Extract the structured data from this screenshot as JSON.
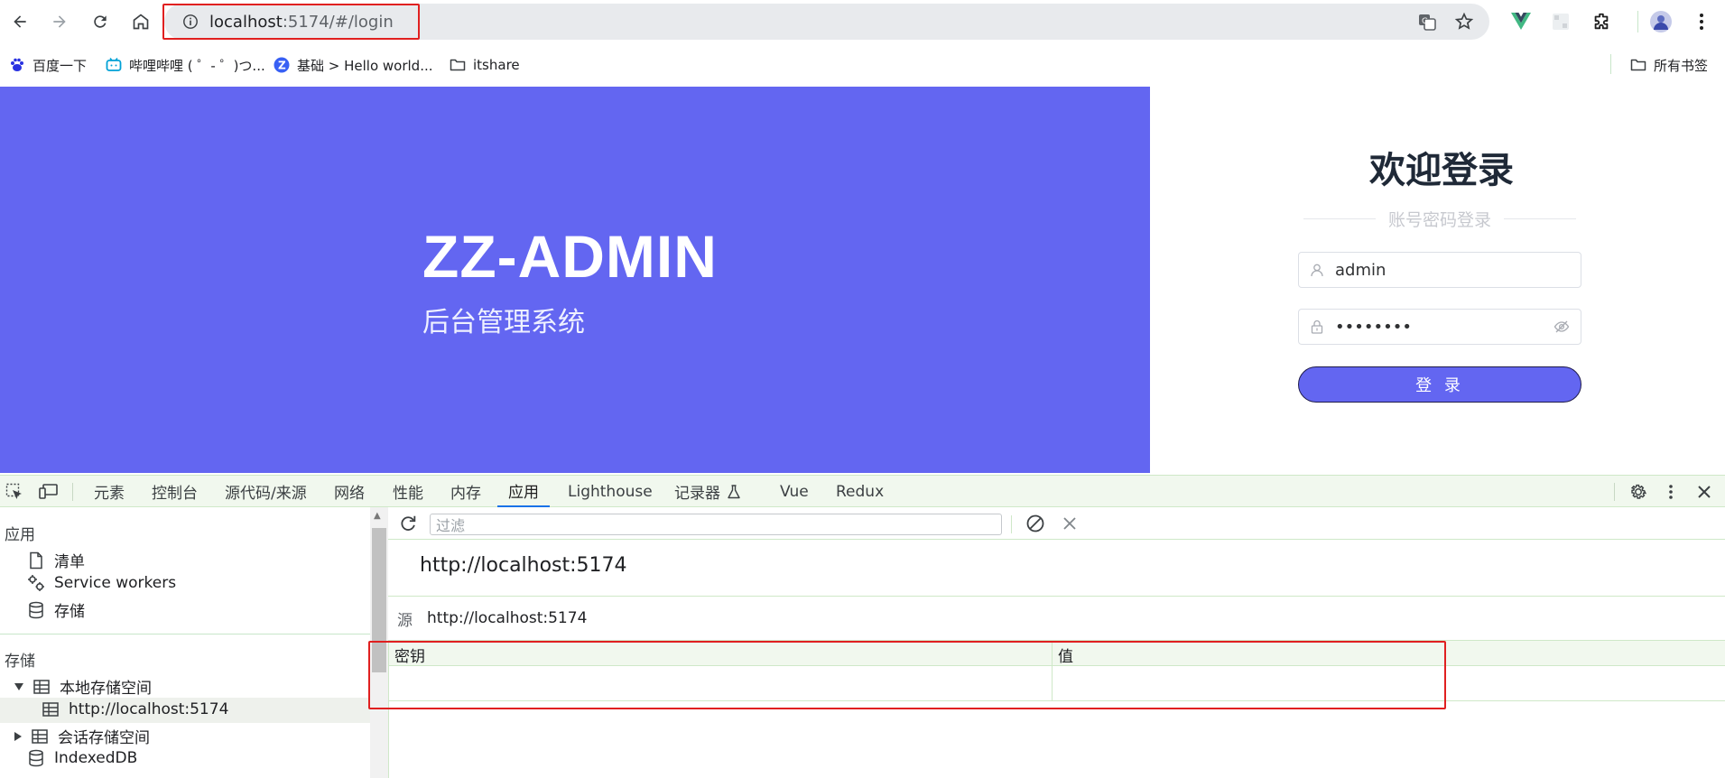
{
  "browser": {
    "url_host": "localhost",
    "url_rest": ":5174/#/login",
    "bookmarks": [
      {
        "label": "百度一下",
        "icon": "baidu-icon"
      },
      {
        "label": "哔哩哔哩 ( ゜- ゜)つ...",
        "icon": "bilibili-icon"
      },
      {
        "label": "基础 > Hello world...",
        "icon": "z-icon"
      },
      {
        "label": "itshare",
        "icon": "folder-icon"
      }
    ],
    "all_bookmarks": "所有书签"
  },
  "page": {
    "hero_title": "ZZ-ADMIN",
    "hero_subtitle": "后台管理系统",
    "login_title": "欢迎登录",
    "login_subtitle": "账号密码登录",
    "username_value": "admin",
    "password_value": "••••••••",
    "login_button": "登 录",
    "colors": {
      "brand": "#6366f1"
    }
  },
  "devtools": {
    "tabs": [
      "元素",
      "控制台",
      "源代码/来源",
      "网络",
      "性能",
      "内存",
      "应用",
      "Lighthouse",
      "记录器",
      "Vue",
      "Redux"
    ],
    "active_tab": "应用",
    "sidebar": {
      "section_app": "应用",
      "app_items": [
        "清单",
        "Service workers",
        "存储"
      ],
      "section_storage": "存储",
      "local_storage": "本地存储空间",
      "local_origin": "http://localhost:5174",
      "session_storage": "会话存储空间",
      "indexeddb": "IndexedDB"
    },
    "filter_placeholder": "过滤",
    "origin_title": "http://localhost:5174",
    "origin_label": "源",
    "origin_value": "http://localhost:5174",
    "table_headers": {
      "key": "密钥",
      "value": "值"
    }
  }
}
